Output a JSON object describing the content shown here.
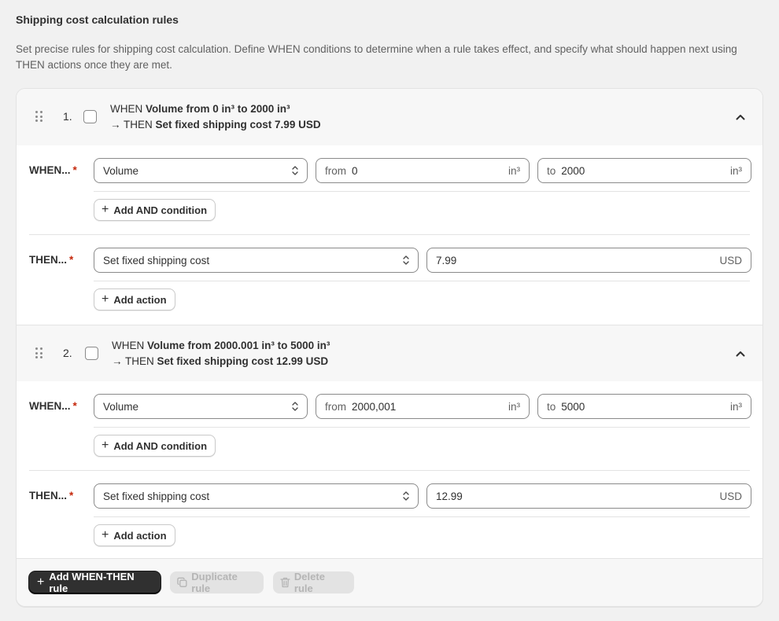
{
  "page": {
    "title": "Shipping cost calculation rules",
    "description": "Set precise rules for shipping cost calculation. Define WHEN conditions to determine when a rule takes effect, and specify what should happen next using THEN actions once they are met."
  },
  "labels": {
    "when": "WHEN...",
    "then": "THEN...",
    "required_mark": "*",
    "when_word": "WHEN",
    "then_word": "→ THEN",
    "add_and_condition": "Add AND condition",
    "add_action": "Add action"
  },
  "rules": [
    {
      "number": "1.",
      "summary_when": "Volume from 0 in³ to 2000 in³",
      "summary_then": "Set fixed shipping cost 7.99 USD",
      "condition": {
        "field": "Volume",
        "from_prefix": "from",
        "from_value": "0",
        "from_unit": "in³",
        "to_prefix": "to",
        "to_value": "2000",
        "to_unit": "in³"
      },
      "action": {
        "type": "Set fixed shipping cost",
        "value": "7.99",
        "currency": "USD"
      }
    },
    {
      "number": "2.",
      "summary_when": "Volume from 2000.001 in³ to 5000 in³",
      "summary_then": "Set fixed shipping cost 12.99 USD",
      "condition": {
        "field": "Volume",
        "from_prefix": "from",
        "from_value": "2000,001",
        "from_unit": "in³",
        "to_prefix": "to",
        "to_value": "5000",
        "to_unit": "in³"
      },
      "action": {
        "type": "Set fixed shipping cost",
        "value": "12.99",
        "currency": "USD"
      }
    }
  ],
  "footer": {
    "add_rule": "Add WHEN-THEN rule",
    "duplicate_rule": "Duplicate rule",
    "delete_rule": "Delete rule"
  },
  "colors": {
    "required": "#c5280c",
    "primary_button": "#303030",
    "disabled_button": "#e3e3e3"
  }
}
